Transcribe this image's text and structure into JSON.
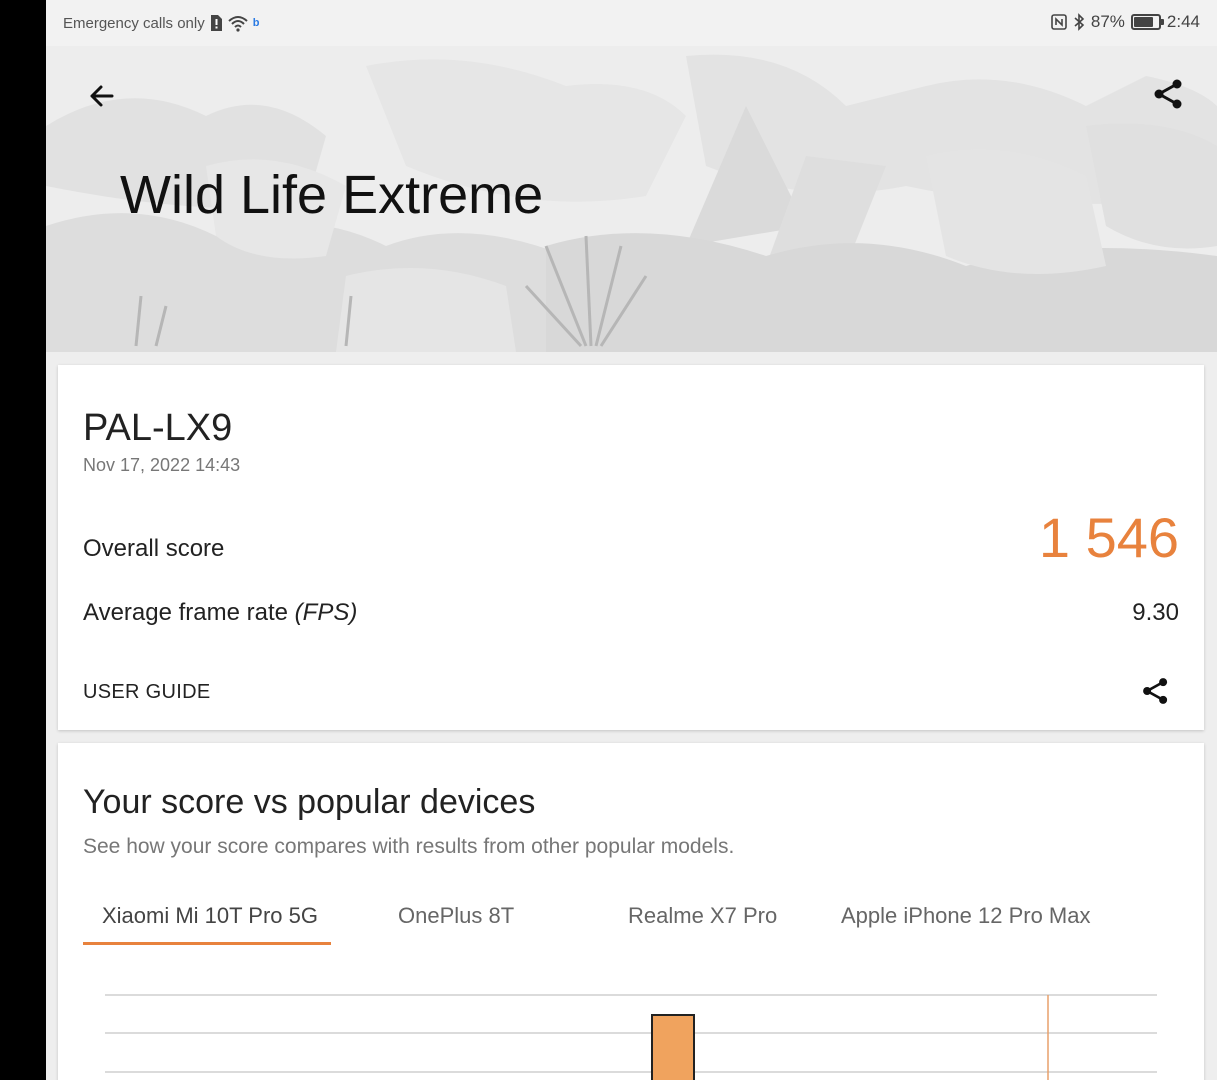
{
  "status_bar": {
    "left_text": "Emergency calls only",
    "battery": "87%",
    "battery_level": 0.87,
    "time": "2:44"
  },
  "header": {
    "title": "Wild Life Extreme"
  },
  "result": {
    "device_name": "PAL-LX9",
    "date": "Nov 17, 2022 14:43",
    "overall_label": "Overall score",
    "overall_value": "1 546",
    "fps_label": "Average frame rate",
    "fps_unit": "(FPS)",
    "fps_value": "9.30",
    "user_guide": "USER GUIDE"
  },
  "compare": {
    "title": "Your score vs popular devices",
    "subtitle": "See how your score compares with results from other popular models.",
    "tabs": [
      {
        "label": "Xiaomi Mi 10T Pro 5G",
        "selected": true
      },
      {
        "label": "OnePlus 8T",
        "selected": false
      },
      {
        "label": "Realme X7 Pro",
        "selected": false
      },
      {
        "label": "Apple iPhone 12 Pro Max",
        "selected": false
      }
    ]
  },
  "colors": {
    "accent": "#e8823d",
    "bar": "#f0a35e"
  }
}
